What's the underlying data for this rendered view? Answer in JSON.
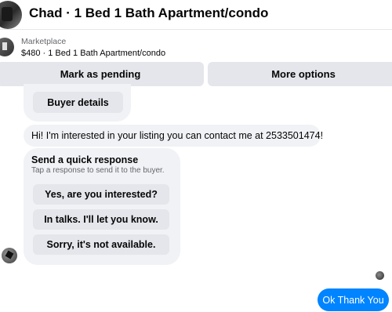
{
  "header": {
    "title": "Chad · 1 Bed 1 Bath Apartment/condo"
  },
  "listing": {
    "label": "Marketplace",
    "description": "$480 · 1 Bed 1 Bath Apartment/condo"
  },
  "actions": {
    "pending_label": "Mark as pending",
    "more_label": "More options"
  },
  "messages": {
    "buyer_details_label": "Buyer details",
    "interest_text": "Hi! I'm interested in your listing you can contact me at 2533501474!",
    "quick_response": {
      "title": "Send a quick response",
      "subtitle": "Tap a response to send it to the buyer.",
      "options": [
        "Yes, are you interested?",
        "In talks. I'll let you know.",
        "Sorry, it's not available."
      ]
    },
    "outgoing_text": "Ok Thank You"
  },
  "colors": {
    "accent": "#0084ff",
    "bubble": "#f0f2f5",
    "button": "#e4e6eb"
  }
}
